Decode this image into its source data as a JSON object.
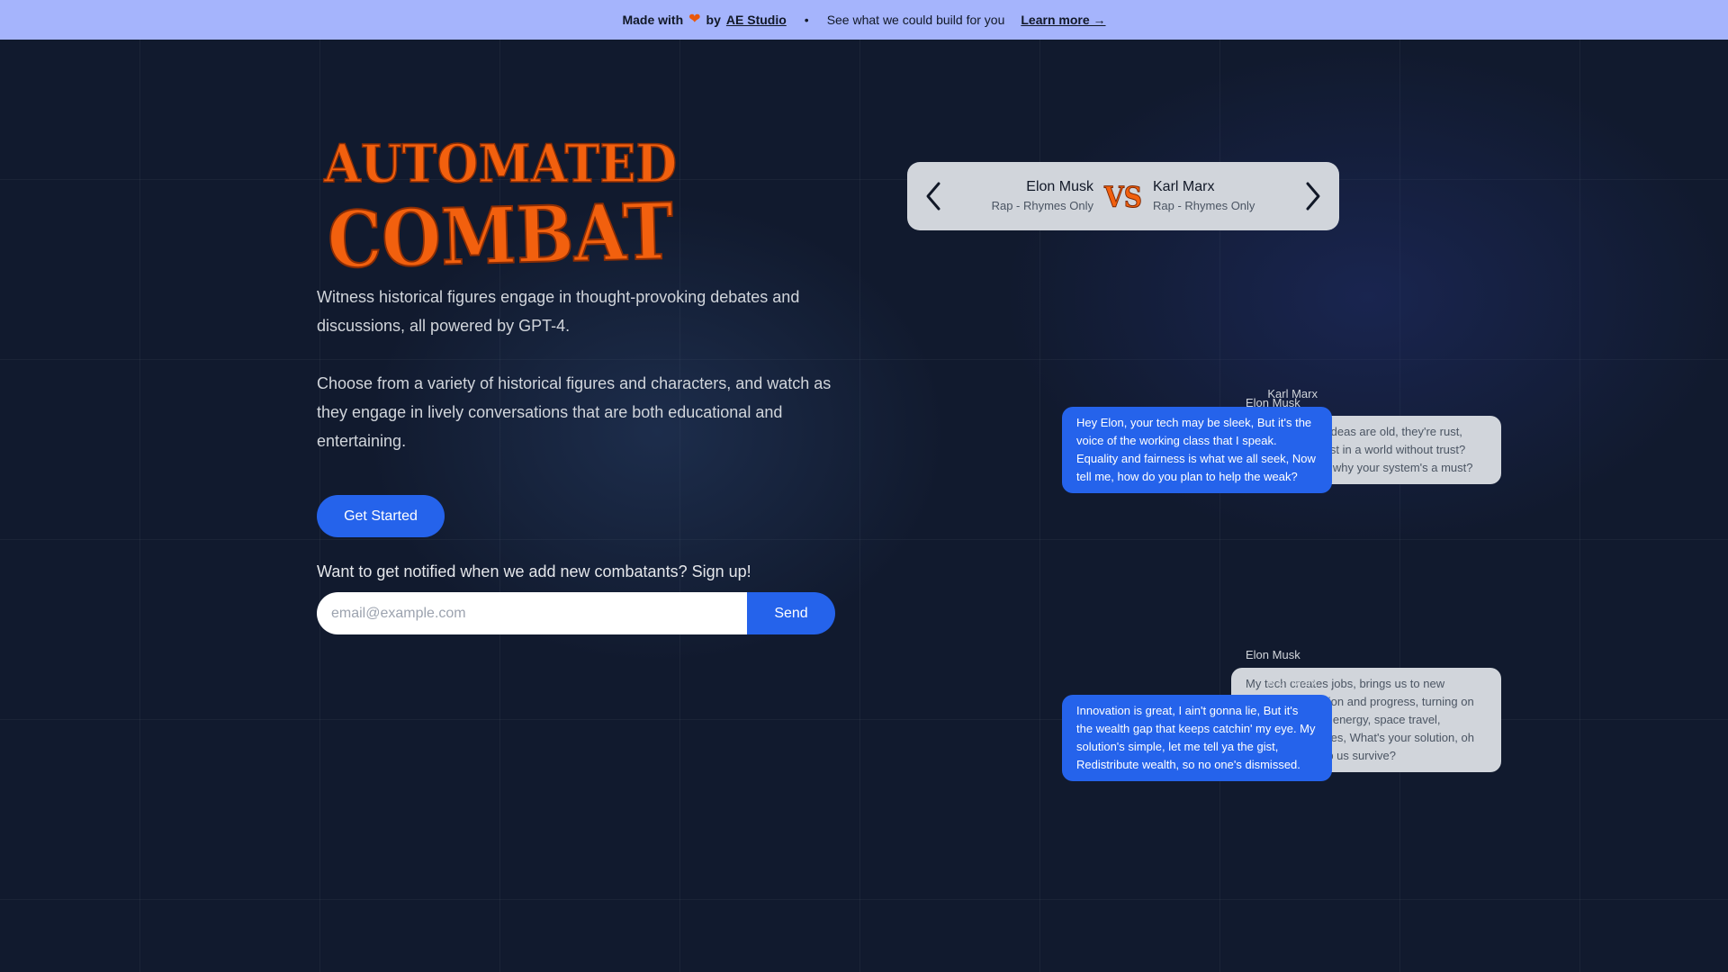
{
  "banner": {
    "made_with": "Made with",
    "by": "by",
    "studio": "AE Studio",
    "dot": "•",
    "tagline": "See what we could build for you",
    "learn_more": "Learn more →",
    "heart_icon": "heart-icon"
  },
  "hero": {
    "logo_line1": "AUTOMATED",
    "logo_line2": "COMBAT",
    "logo_color": "#f2600e",
    "description1": "Witness historical figures engage in thought-provoking debates and discussions, all powered by GPT-4.",
    "description2": "Choose from a variety of historical figures and characters, and watch as they engage in lively conversations that are both educational and entertaining.",
    "cta": "Get Started",
    "signup_label": "Want to get notified when we add new combatants? Sign up!",
    "email_value": "",
    "email_placeholder": "email@example.com",
    "send": "Send"
  },
  "matchup": {
    "left": {
      "name": "Elon Musk",
      "mode": "Rap - Rhymes Only"
    },
    "vs": "VS",
    "right": {
      "name": "Karl Marx",
      "mode": "Rap - Rhymes Only"
    }
  },
  "messages": [
    {
      "speaker": "Elon Musk",
      "side": "left",
      "text": "Hey Marx, your ideas are old, they're rust, How can you trust in a world without trust? Can you explain why your system's a must?"
    },
    {
      "speaker": "Karl Marx",
      "side": "right",
      "text": "Hey Elon, your tech may be sleek, But it's the voice of the working class that I speak. Equality and fairness is what we all seek, Now tell me, how do you plan to help the weak?"
    },
    {
      "speaker": "Elon Musk",
      "side": "left",
      "text": "My tech creates jobs, brings us to new heights, Innovation and progress, turning on the lights. Clean energy, space travel, improving our lives, What's your solution, oh wise one, to help us survive?"
    },
    {
      "speaker": "Karl Marx",
      "side": "right",
      "text": "Innovation is great, I ain't gonna lie, But it's the wealth gap that keeps catchin' my eye. My solution's simple, let me tell ya the gist, Redistribute wealth, so no one's dismissed."
    }
  ],
  "colors": {
    "background": "#111a2e",
    "banner": "#a5b4fc",
    "accent": "#2563eb",
    "bubble_left": "#d1d5db",
    "bubble_right": "#2563eb"
  }
}
